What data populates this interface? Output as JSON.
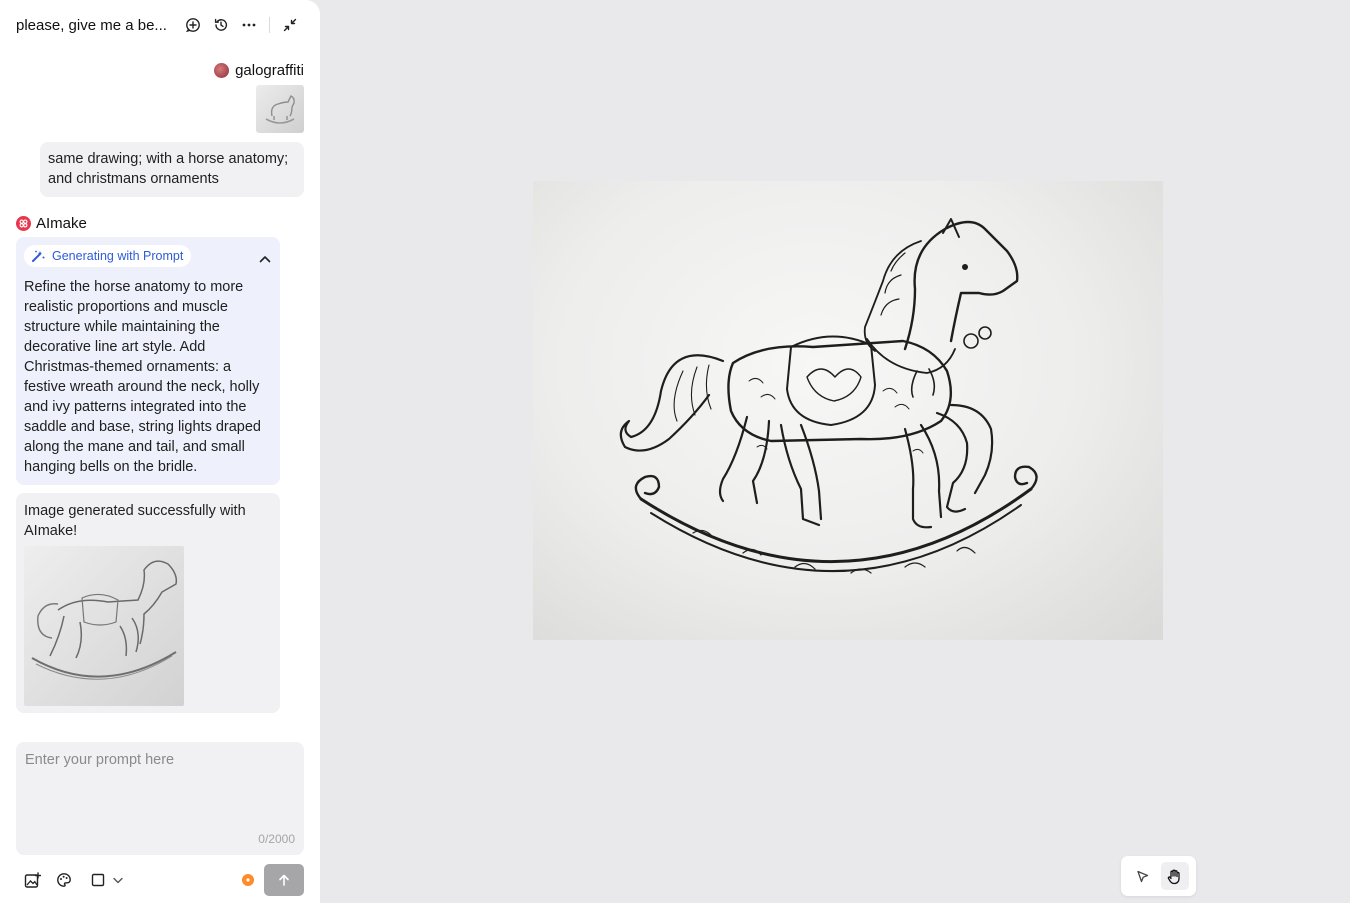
{
  "header": {
    "title": "please, give me a be..."
  },
  "chat": {
    "user": {
      "name": "galograffiti",
      "message": "same drawing; with a horse anatomy; and christmans ornaments"
    },
    "bot": {
      "name": "AImake",
      "prompt_chip": "Generating with Prompt",
      "prompt_text": "Refine the horse anatomy to more realistic proportions and muscle structure while maintaining the decorative line art style. Add Christmas-themed ornaments: a festive wreath around the neck, holly and ivy patterns integrated into the saddle and base, string lights draped along the mane and tail, and small hanging bells on the bridle.",
      "result_text": "Image generated successfully with AImake!"
    }
  },
  "input": {
    "placeholder": "Enter your prompt here",
    "counter": "0/2000"
  },
  "icons": {
    "header": [
      "new-chat-icon",
      "history-icon",
      "more-icon",
      "collapse-icon"
    ],
    "toolbar": [
      "add-image-icon",
      "palette-icon",
      "aspect-ratio-icon",
      "chevron-down-icon",
      "credit-icon",
      "arrow-up-icon"
    ],
    "canvas_tools": [
      "pointer-icon",
      "hand-icon"
    ]
  },
  "colors": {
    "accent": "#2e5bd9",
    "bot_brand": "#e8364f",
    "credit": "#ff8c2a",
    "send_disabled": "#a6a6a8",
    "canvas_bg": "#e9e9ec"
  }
}
